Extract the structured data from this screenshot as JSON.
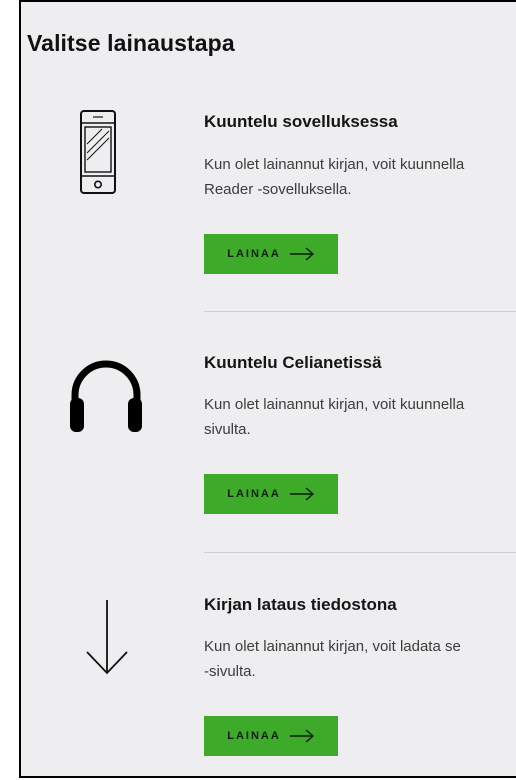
{
  "heading": "Valitse lainaustapa",
  "options": [
    {
      "icon": "smartphone-icon",
      "title": "Kuuntelu sovelluksessa",
      "desc_line1": "Kun olet lainannut kirjan, voit kuunnella",
      "desc_line2": "Reader -sovelluksella.",
      "button_label": "LAINAA",
      "button_icon": "arrow-right-icon"
    },
    {
      "icon": "headphones-icon",
      "title": "Kuuntelu Celianetissä",
      "desc_line1": "Kun olet lainannut kirjan, voit kuunnella",
      "desc_line2": "sivulta.",
      "button_label": "LAINAA",
      "button_icon": "arrow-right-icon"
    },
    {
      "icon": "arrow-down-icon",
      "title": "Kirjan lataus tiedostona",
      "desc_line1": "Kun olet lainannut kirjan, voit ladata se",
      "desc_line2": "-sivulta.",
      "button_label": "LAINAA",
      "button_icon": "arrow-right-icon"
    }
  ],
  "colors": {
    "button_bg": "#3daa2a",
    "panel_bg": "#eeeef0"
  }
}
